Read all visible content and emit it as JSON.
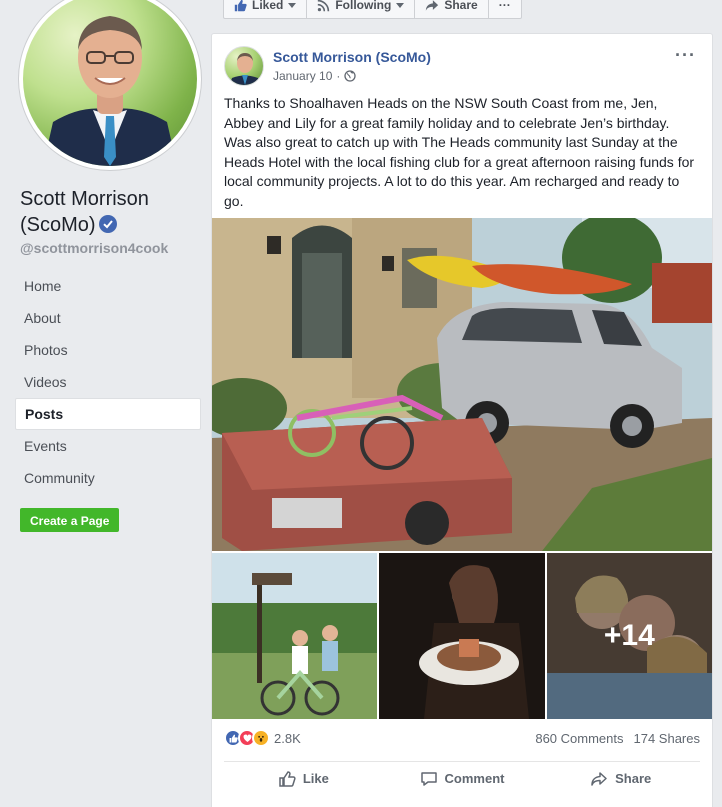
{
  "page": {
    "name_line1": "Scott Morrison",
    "name_line2": "(ScoMo)",
    "handle": "@scottmorrison4cook"
  },
  "nav": {
    "items": [
      "Home",
      "About",
      "Photos",
      "Videos",
      "Posts",
      "Events",
      "Community"
    ],
    "active": "Posts",
    "create_page": "Create a Page"
  },
  "action_bar": {
    "liked": "Liked",
    "following": "Following",
    "share": "Share",
    "more": "···"
  },
  "post": {
    "author": "Scott Morrison (ScoMo)",
    "date": "January 10",
    "date_separator": "·",
    "privacy_icon": "globe-icon",
    "text": "Thanks to Shoalhaven Heads on the NSW South Coast from me, Jen, Abbey and Lily for a great family holiday and to celebrate Jen’s birthday. Was also great to catch up with The Heads community last Sunday at the Heads Hotel with the local fishing club for a great afternoon raising funds for local community projects. A lot to do this year. Am recharged and ready to go.",
    "more_photos": "+14",
    "reactions_count": "2.8K",
    "reactions": [
      "like",
      "love",
      "wow"
    ],
    "comments": "860 Comments",
    "shares": "174 Shares",
    "actions": {
      "like": "Like",
      "comment": "Comment",
      "share": "Share"
    }
  },
  "colors": {
    "link": "#365899",
    "facebook_blue": "#4267b2",
    "create_green": "#42b72a",
    "love_red": "#f33e58",
    "wow_yellow": "#f7b125"
  }
}
